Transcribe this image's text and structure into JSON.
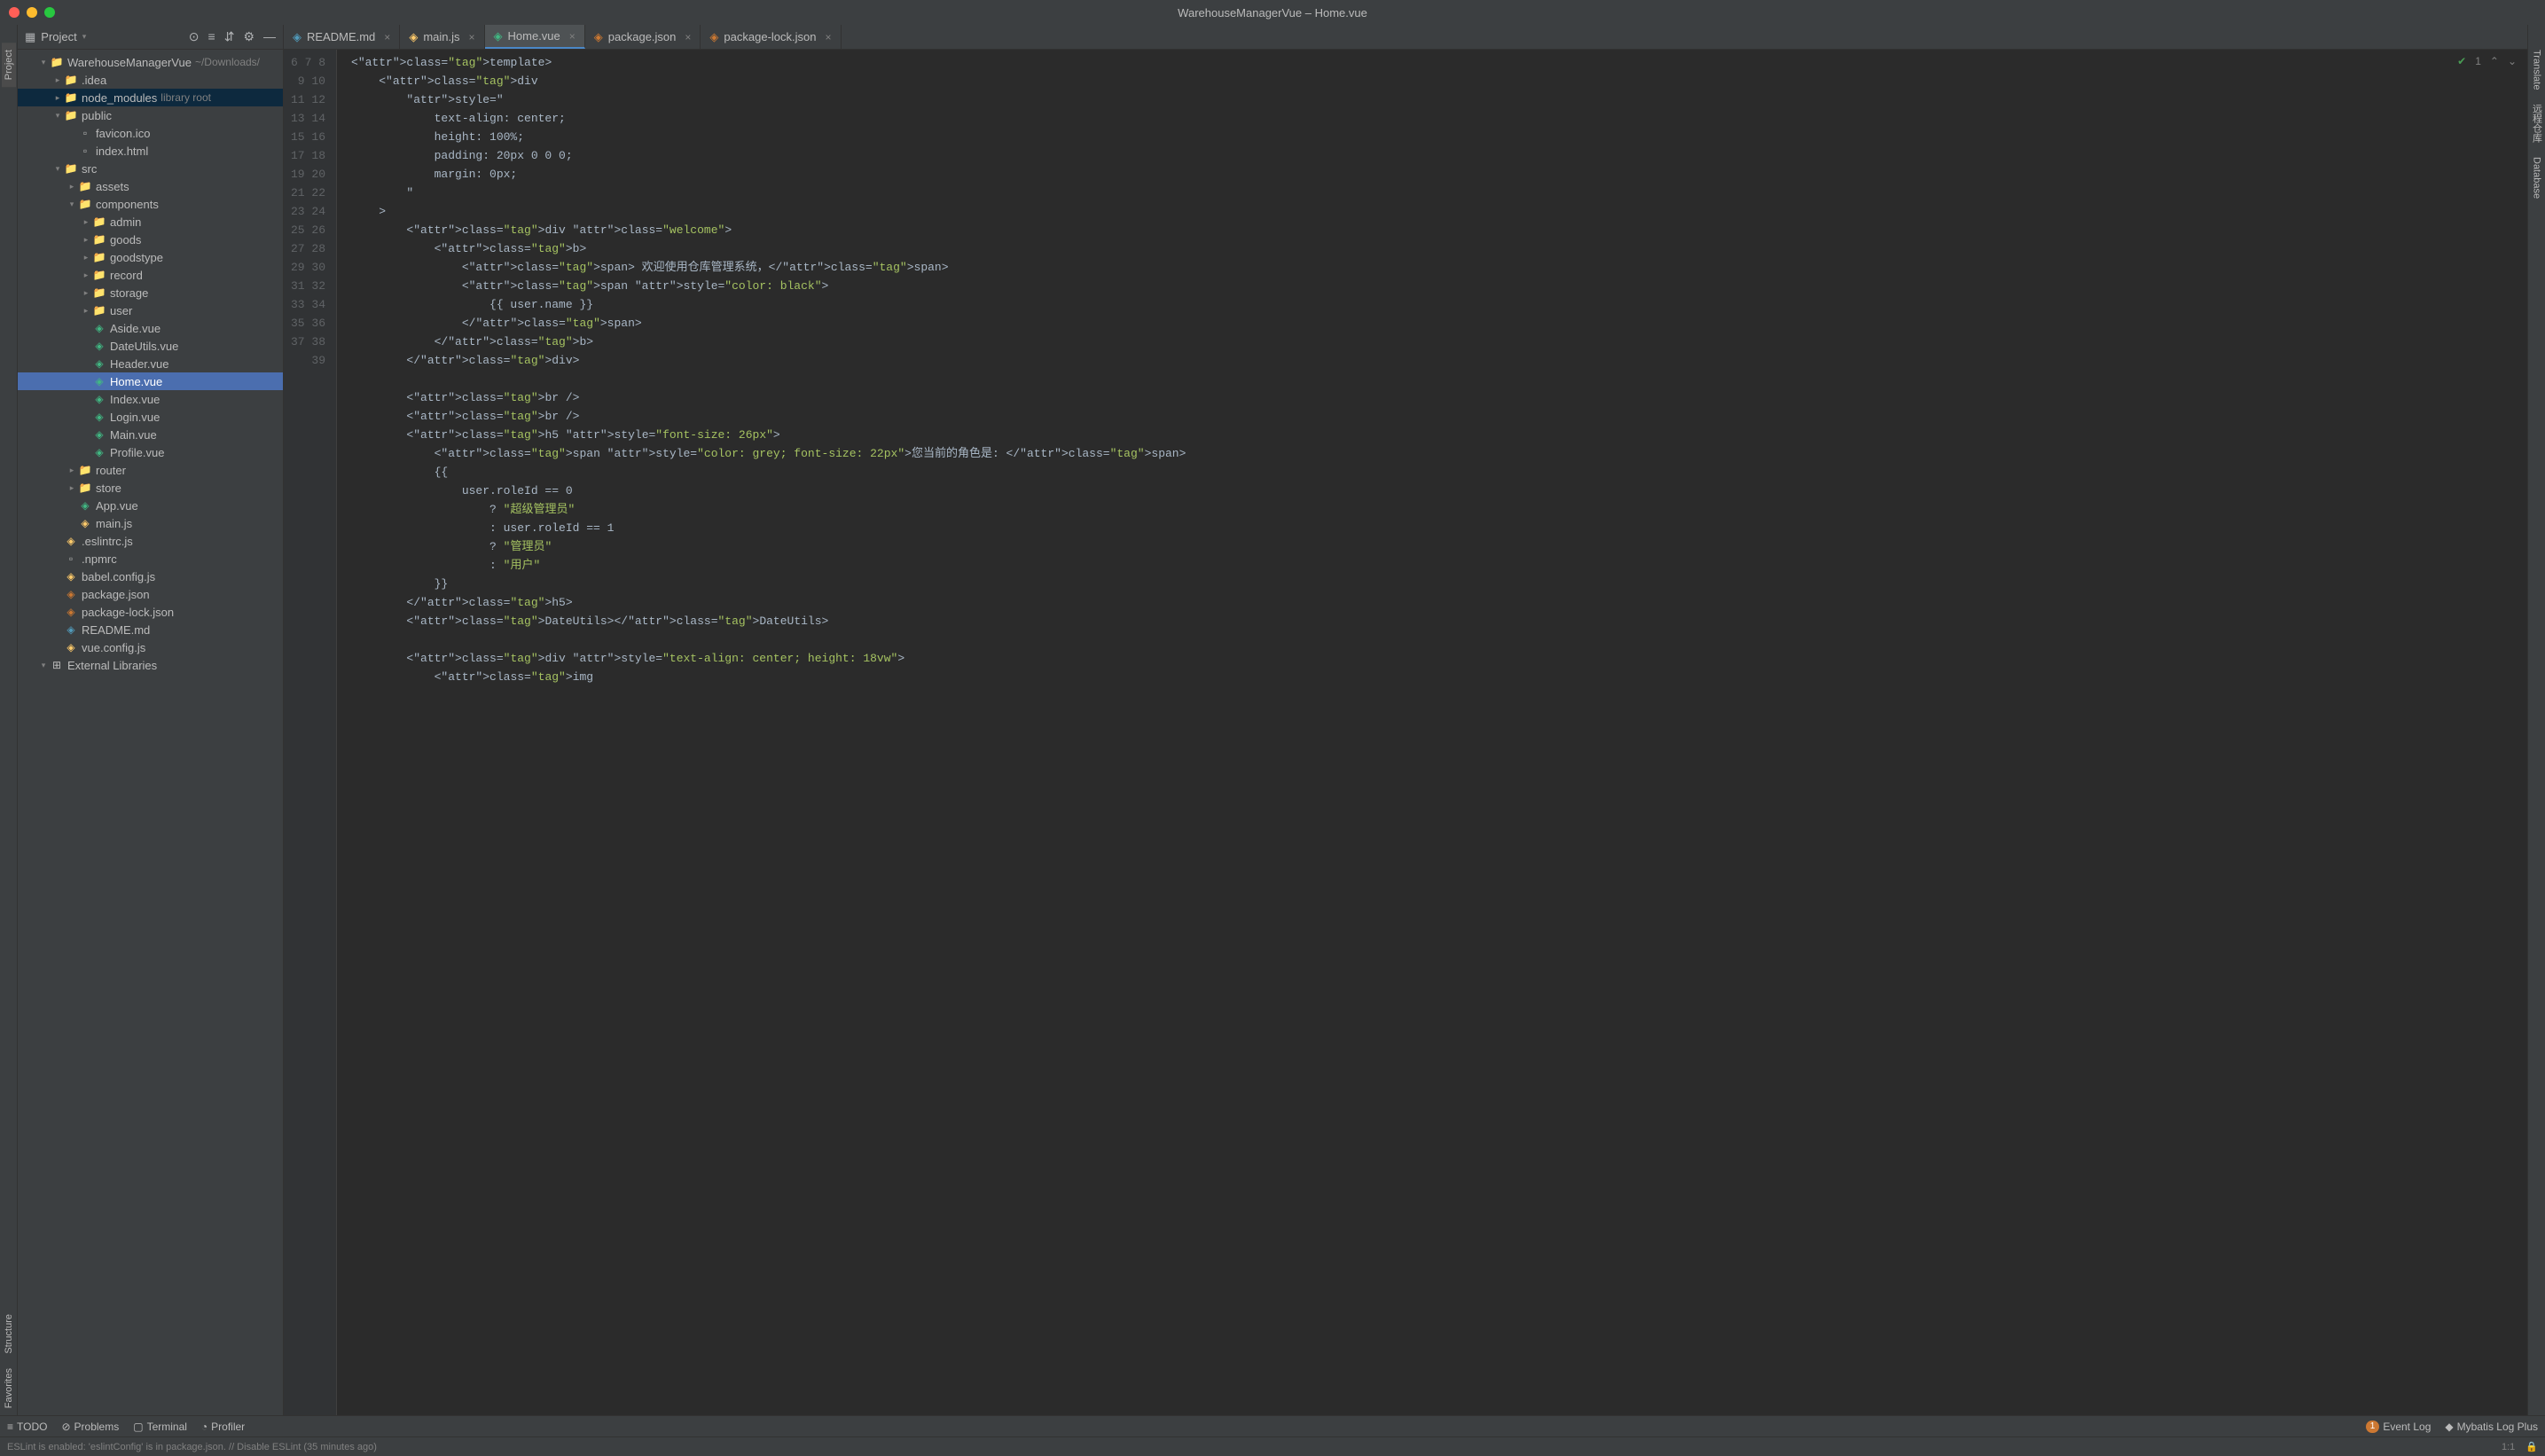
{
  "titlebar": {
    "title": "WarehouseManagerVue – Home.vue"
  },
  "left_rail": {
    "project": "Project",
    "structure": "Structure",
    "favorites": "Favorites"
  },
  "right_rail": {
    "translate": "Translate",
    "lib1": "远程仓库",
    "database": "Database"
  },
  "sidebar": {
    "header": "Project",
    "root": {
      "name": "WarehouseManagerVue",
      "path": "~/Downloads/"
    },
    "tree": [
      {
        "d": 1,
        "chev": "v",
        "icon": "folder",
        "label": "WarehouseManagerVue",
        "hint": "~/Downloads/"
      },
      {
        "d": 2,
        "chev": ">",
        "icon": "folder",
        "label": ".idea"
      },
      {
        "d": 2,
        "chev": ">",
        "icon": "folder",
        "label": "node_modules",
        "hint": "library root",
        "hl": true
      },
      {
        "d": 2,
        "chev": "v",
        "icon": "folder",
        "label": "public"
      },
      {
        "d": 3,
        "chev": "",
        "icon": "file",
        "label": "favicon.ico"
      },
      {
        "d": 3,
        "chev": "",
        "icon": "file",
        "label": "index.html"
      },
      {
        "d": 2,
        "chev": "v",
        "icon": "folder",
        "label": "src"
      },
      {
        "d": 3,
        "chev": ">",
        "icon": "folder",
        "label": "assets"
      },
      {
        "d": 3,
        "chev": "v",
        "icon": "folder",
        "label": "components"
      },
      {
        "d": 4,
        "chev": ">",
        "icon": "folder",
        "label": "admin"
      },
      {
        "d": 4,
        "chev": ">",
        "icon": "folder",
        "label": "goods"
      },
      {
        "d": 4,
        "chev": ">",
        "icon": "folder",
        "label": "goodstype"
      },
      {
        "d": 4,
        "chev": ">",
        "icon": "folder",
        "label": "record"
      },
      {
        "d": 4,
        "chev": ">",
        "icon": "folder",
        "label": "storage"
      },
      {
        "d": 4,
        "chev": ">",
        "icon": "folder",
        "label": "user"
      },
      {
        "d": 4,
        "chev": "",
        "icon": "vue",
        "label": "Aside.vue"
      },
      {
        "d": 4,
        "chev": "",
        "icon": "vue",
        "label": "DateUtils.vue"
      },
      {
        "d": 4,
        "chev": "",
        "icon": "vue",
        "label": "Header.vue"
      },
      {
        "d": 4,
        "chev": "",
        "icon": "vue",
        "label": "Home.vue",
        "sel": true
      },
      {
        "d": 4,
        "chev": "",
        "icon": "vue",
        "label": "Index.vue"
      },
      {
        "d": 4,
        "chev": "",
        "icon": "vue",
        "label": "Login.vue"
      },
      {
        "d": 4,
        "chev": "",
        "icon": "vue",
        "label": "Main.vue"
      },
      {
        "d": 4,
        "chev": "",
        "icon": "vue",
        "label": "Profile.vue"
      },
      {
        "d": 3,
        "chev": ">",
        "icon": "folder",
        "label": "router"
      },
      {
        "d": 3,
        "chev": ">",
        "icon": "folder",
        "label": "store"
      },
      {
        "d": 3,
        "chev": "",
        "icon": "vue",
        "label": "App.vue"
      },
      {
        "d": 3,
        "chev": "",
        "icon": "js",
        "label": "main.js"
      },
      {
        "d": 2,
        "chev": "",
        "icon": "js",
        "label": ".eslintrc.js"
      },
      {
        "d": 2,
        "chev": "",
        "icon": "file",
        "label": ".npmrc"
      },
      {
        "d": 2,
        "chev": "",
        "icon": "js",
        "label": "babel.config.js"
      },
      {
        "d": 2,
        "chev": "",
        "icon": "json",
        "label": "package.json"
      },
      {
        "d": 2,
        "chev": "",
        "icon": "json",
        "label": "package-lock.json"
      },
      {
        "d": 2,
        "chev": "",
        "icon": "md",
        "label": "README.md"
      },
      {
        "d": 2,
        "chev": "",
        "icon": "js",
        "label": "vue.config.js"
      },
      {
        "d": 1,
        "chev": "v",
        "icon": "lib",
        "label": "External Libraries"
      }
    ]
  },
  "tabs": [
    {
      "icon": "md",
      "label": "README.md"
    },
    {
      "icon": "js",
      "label": "main.js"
    },
    {
      "icon": "vue",
      "label": "Home.vue",
      "active": true
    },
    {
      "icon": "json",
      "label": "package.json"
    },
    {
      "icon": "json",
      "label": "package-lock.json"
    }
  ],
  "editor": {
    "first_line": 6,
    "badge": "1",
    "lines": [
      "<template>",
      "    <div",
      "        style=\"",
      "            text-align: center;",
      "            height: 100%;",
      "            padding: 20px 0 0 0;",
      "            margin: 0px;",
      "        \"",
      "    >",
      "        <div class=\"welcome\">",
      "            <b>",
      "                <span> 欢迎使用仓库管理系统，</span>",
      "                <span style=\"color: black\">",
      "                    {{ user.name }}",
      "                </span>",
      "            </b>",
      "        </div>",
      "",
      "        <br />",
      "        <br />",
      "        <h5 style=\"font-size: 26px\">",
      "            <span style=\"color: grey; font-size: 22px\">您当前的角色是: </span>",
      "            {{",
      "                user.roleId == 0",
      "                    ? \"超级管理员\"",
      "                    : user.roleId == 1",
      "                    ? \"管理员\"",
      "                    : \"用户\"",
      "            }}",
      "        </h5>",
      "        <DateUtils></DateUtils>",
      "",
      "        <div style=\"text-align: center; height: 18vw\">",
      "            <img"
    ]
  },
  "bottom_tabs": {
    "todo": "TODO",
    "problems": "Problems",
    "terminal": "Terminal",
    "profiler": "Profiler",
    "event_log": "Event Log",
    "event_count": "1",
    "mybatis": "Mybatis Log Plus"
  },
  "statusbar": {
    "message": "ESLint is enabled: 'eslintConfig' is in package.json. // Disable ESLint (35 minutes ago)",
    "pos": "1:1"
  }
}
